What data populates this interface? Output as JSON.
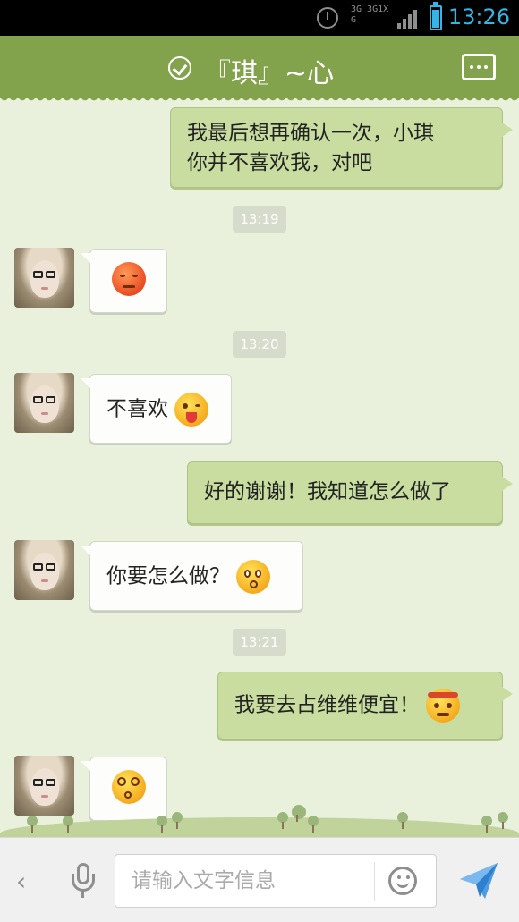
{
  "status_bar": {
    "time": "13:26",
    "network": "3G 3G1X G",
    "battery_level": 0.85
  },
  "header": {
    "title": "『琪』~心"
  },
  "messages": [
    {
      "direction": "out",
      "text_line1": "我最后想再确认一次，小琪",
      "text_line2": "你并不喜欢我，对吧"
    },
    {
      "timestamp": "13:19"
    },
    {
      "direction": "in",
      "emoji": "pensive-face-icon"
    },
    {
      "timestamp": "13:20"
    },
    {
      "direction": "in",
      "text": "不喜欢",
      "emoji": "tongue-wink-face-icon"
    },
    {
      "direction": "out",
      "text": "好的谢谢！我知道怎么做了"
    },
    {
      "direction": "in",
      "text": "你要怎么做？",
      "emoji": "surprised-face-icon"
    },
    {
      "timestamp": "13:21"
    },
    {
      "direction": "out",
      "text": "我要去占维维便宜！",
      "emoji": "headband-angry-face-icon"
    },
    {
      "direction": "in",
      "emoji": "dizzy-face-icon"
    }
  ],
  "input": {
    "placeholder": "请输入文字信息"
  },
  "colors": {
    "header": "#83a24c",
    "outgoing_bubble": "#c8dd9f",
    "incoming_bubble": "#fdfdfb",
    "background": "#e9f1dd"
  }
}
